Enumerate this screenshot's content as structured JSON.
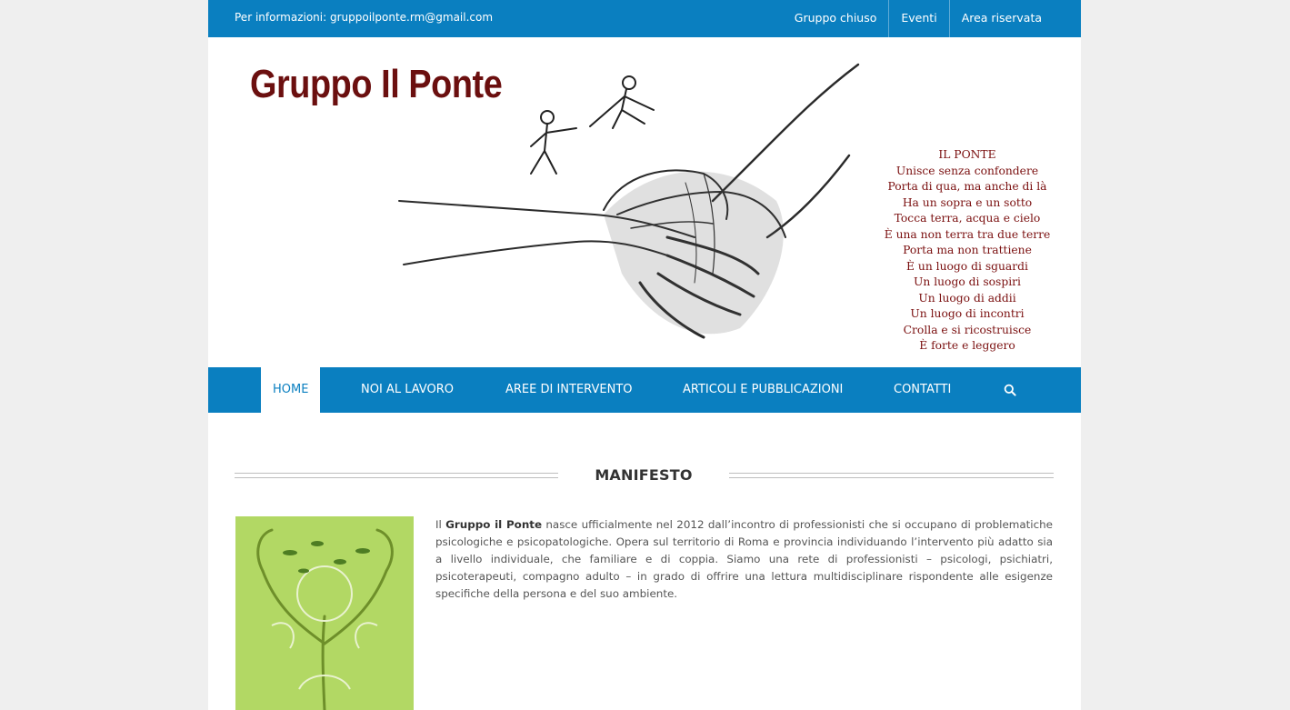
{
  "topbar": {
    "info": "Per informazioni: gruppoilponte.rm@gmail.com",
    "links": [
      "Gruppo chiuso",
      "Eventi",
      "Area riservata"
    ]
  },
  "header": {
    "logo": "Gruppo Il Ponte",
    "poem": [
      "IL PONTE",
      "Unisce senza confondere",
      "Porta di qua, ma anche di là",
      "Ha un sopra e un sotto",
      "Tocca terra, acqua e cielo",
      "È una non terra tra due terre",
      "Porta ma non trattiene",
      "È un luogo di sguardi",
      "Un luogo di sospiri",
      "Un luogo di addii",
      "Un luogo di incontri",
      "Crolla e si ricostruisce",
      "È forte e leggero"
    ]
  },
  "nav": {
    "items": [
      "HOME",
      "NOI AL LAVORO",
      "AREE DI INTERVENTO",
      "ARTICOLI E PUBBLICAZIONI",
      "CONTATTI"
    ],
    "active": "HOME",
    "search_icon": "search-icon"
  },
  "section": {
    "title": "MANIFESTO",
    "text_pre": "Il ",
    "text_bold": "Gruppo il Ponte",
    "text_post": " nasce ufficialmente nel 2012 dall’incontro di professionisti che si occupano di problematiche psicologiche e psicopatologiche. Opera sul territorio di Roma e provincia individuando l’intervento più adatto sia a livello individuale, che familiare e di coppia. Siamo una rete di professionisti – psicologi, psichiatri, psicoterapeuti, compagno adulto – in grado di offrire una lettura multidisciplinare rispondente alle esigenze specifiche della persona e del suo ambiente."
  },
  "colors": {
    "brand_blue": "#0a7fc0",
    "logo_red": "#6b0f0f",
    "background": "#efefef"
  }
}
